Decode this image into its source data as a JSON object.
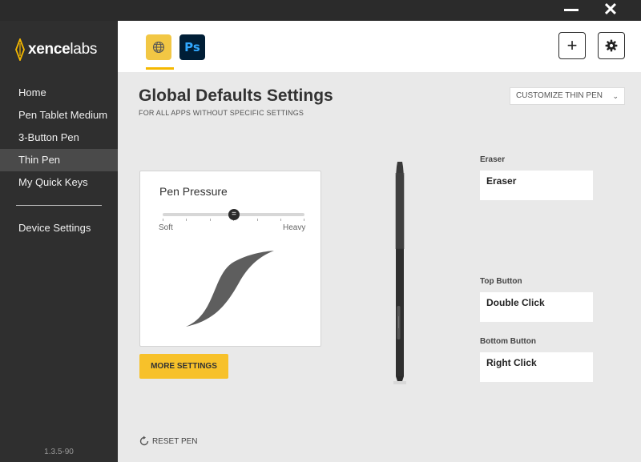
{
  "window": {
    "minimize_icon": "minimize-icon",
    "close_label": "✕"
  },
  "brand": {
    "name_bold": "xence",
    "name_light": "labs",
    "accent": "#f5b800"
  },
  "sidebar": {
    "items": [
      {
        "label": "Home"
      },
      {
        "label": "Pen Tablet Medium"
      },
      {
        "label": "3-Button Pen"
      },
      {
        "label": "Thin Pen",
        "active": true
      },
      {
        "label": "My Quick Keys"
      }
    ],
    "settings_label": "Device Settings",
    "version": "1.3.5-90"
  },
  "header": {
    "apps": [
      {
        "name": "globe-icon",
        "selected": true
      },
      {
        "name": "photoshop-icon",
        "label": "Ps"
      }
    ],
    "add_label": "+",
    "settings_icon": "gear-icon"
  },
  "main": {
    "title": "Global Defaults Settings",
    "subtitle": "FOR ALL APPS WITHOUT SPECIFIC SETTINGS",
    "customize_label": "CUSTOMIZE THIN PEN",
    "customize_chevron": "⌄",
    "pressure": {
      "title": "Pen Pressure",
      "soft_label": "Soft",
      "heavy_label": "Heavy",
      "level": 0.5,
      "thumb_glyph": "="
    },
    "more_settings_label": "MORE SETTINGS",
    "reset_label": "RESET PEN",
    "buttons": [
      {
        "label": "Eraser",
        "value": "Eraser"
      },
      {
        "label": "Top Button",
        "value": "Double Click"
      },
      {
        "label": "Bottom Button",
        "value": "Right Click"
      }
    ]
  }
}
